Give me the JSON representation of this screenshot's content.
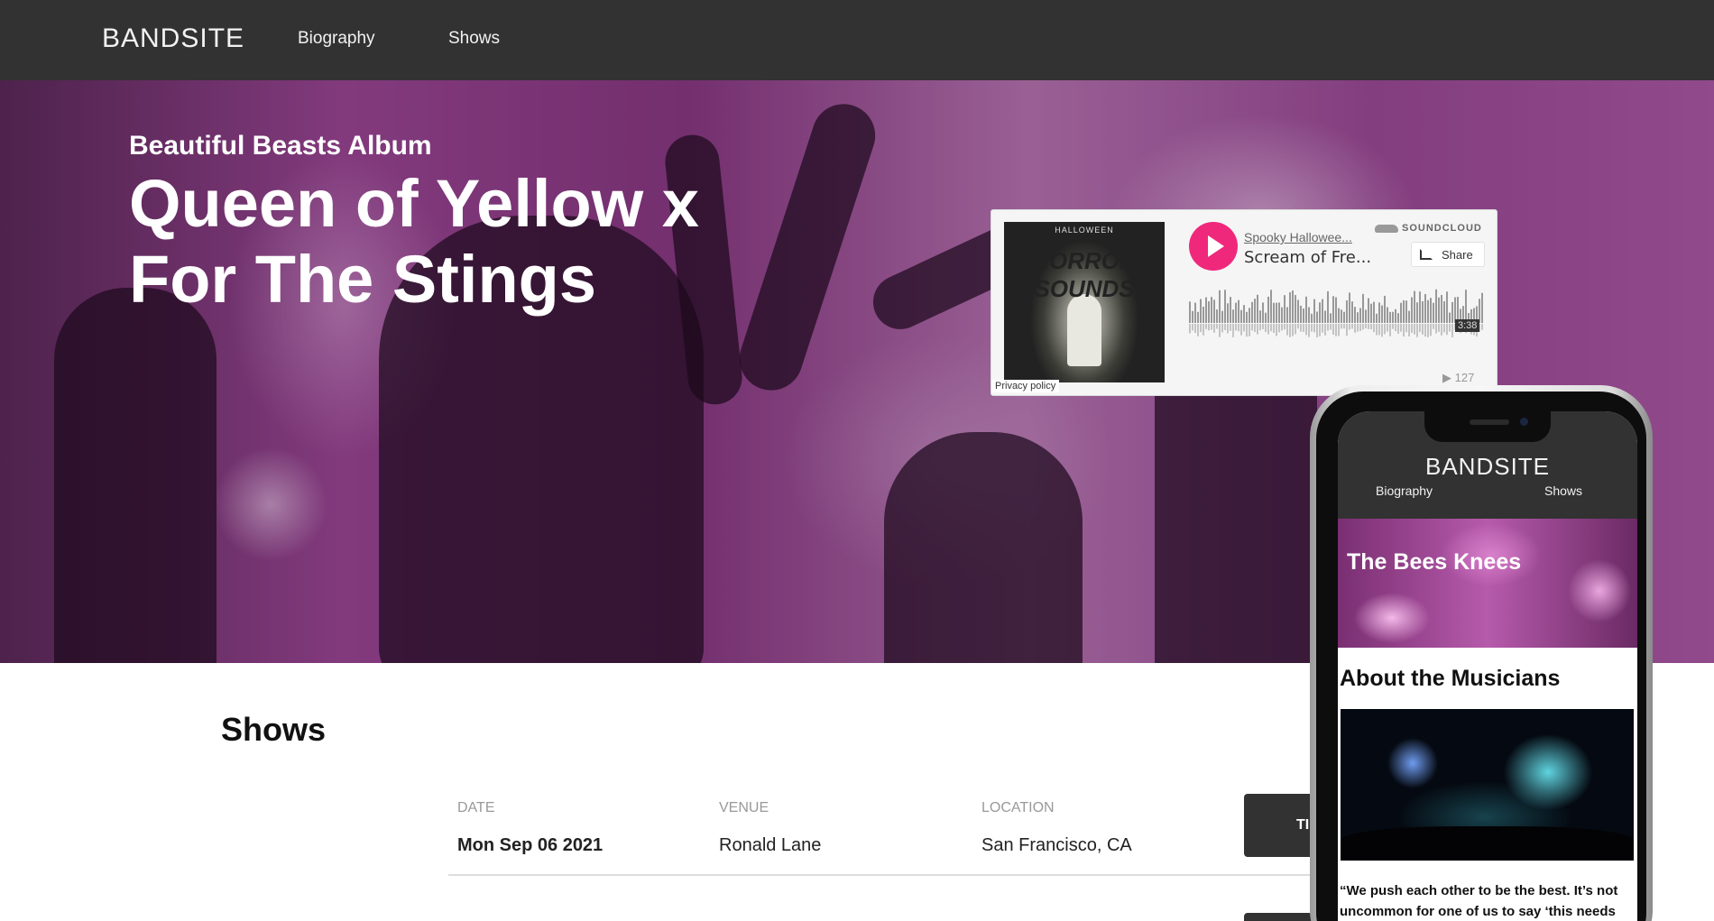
{
  "nav": {
    "brand": "BANDSITE",
    "links": [
      {
        "label": "Biography"
      },
      {
        "label": "Shows"
      }
    ]
  },
  "hero": {
    "kicker": "Beautiful Beasts Album",
    "title": "Queen of Yellow x For The Stings"
  },
  "soundcloud": {
    "art_small_text": "HALLOWEEN",
    "art_big_text": "HORROR SOUNDS",
    "privacy": "Privacy policy",
    "user": "Spooky Hallowee...",
    "track": "Scream of Fre...",
    "logo": "SOUNDCLOUD",
    "share": "Share",
    "duration": "3:38",
    "plays": "127",
    "colors": {
      "play": "#f0287b",
      "wave": "#999999"
    }
  },
  "shows": {
    "title": "Shows",
    "headers": {
      "date": "DATE",
      "venue": "VENUE",
      "location": "LOCATION"
    },
    "rows": [
      {
        "date": "Mon Sep 06 2021",
        "venue": "Ronald Lane",
        "location": "San Francisco, CA",
        "button": "TI"
      }
    ]
  },
  "mobile": {
    "brand": "BANDSITE",
    "nav": [
      "Biography",
      "Shows"
    ],
    "hero_title": "The Bees Knees",
    "about_title": "About the Musicians",
    "quote": "“We push each other to be the best. It’s not uncommon for one of us to say ‘this needs"
  }
}
